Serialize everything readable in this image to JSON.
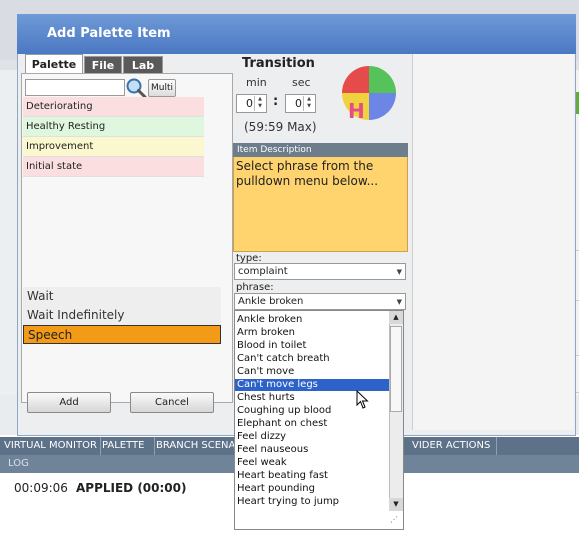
{
  "dialog": {
    "title": "Add Palette Item"
  },
  "tabs": [
    {
      "label": "Palette"
    },
    {
      "label": "File"
    },
    {
      "label": "Lab"
    }
  ],
  "palette": {
    "search_value": "",
    "multi_label": "Multi",
    "items": [
      {
        "label": "Deteriorating"
      },
      {
        "label": "Healthy Resting"
      },
      {
        "label": "Improvement"
      },
      {
        "label": "Initial state"
      }
    ],
    "wait_items": [
      {
        "label": "Wait"
      },
      {
        "label": "Wait Indefinitely"
      },
      {
        "label": "Speech"
      }
    ]
  },
  "buttons": {
    "add": "Add",
    "cancel": "Cancel"
  },
  "transition": {
    "title": "Transition",
    "min_label": "min",
    "sec_label": "sec",
    "min_value": "0",
    "sec_value": "0",
    "colon": ":",
    "max_text": "(59:59 Max)",
    "wheel_letter": "H"
  },
  "item_description": {
    "header": "Item Description",
    "text": "Select phrase from the pulldown menu below..."
  },
  "type": {
    "label": "type:",
    "value": "complaint"
  },
  "phrase": {
    "label": "phrase:",
    "value": "Ankle broken",
    "options": [
      "Ankle broken",
      "Arm broken",
      "Blood in toilet",
      "Can't catch breath",
      "Can't move",
      "Can't move legs",
      "Chest hurts",
      "Coughing up blood",
      "Elephant on chest",
      "Feel dizzy",
      "Feel nauseous",
      "Feel weak",
      "Heart beating fast",
      "Heart pounding",
      "Heart trying to jump"
    ],
    "highlighted": "Can't move legs"
  },
  "bottom_tabs": [
    {
      "label": "VIRTUAL MONITOR"
    },
    {
      "label": "PALETTE"
    },
    {
      "label": "BRANCH SCENARI"
    },
    {
      "label": "VIDER ACTIONS"
    }
  ],
  "log": {
    "label": "LOG",
    "time": "00:09:06",
    "message": "APPLIED (00:00)"
  },
  "colors": {
    "title_bar": "#5a86cc",
    "selected_item": "#f39a16",
    "highlight": "#2d63c8",
    "desc_bg": "#ffd36e"
  }
}
